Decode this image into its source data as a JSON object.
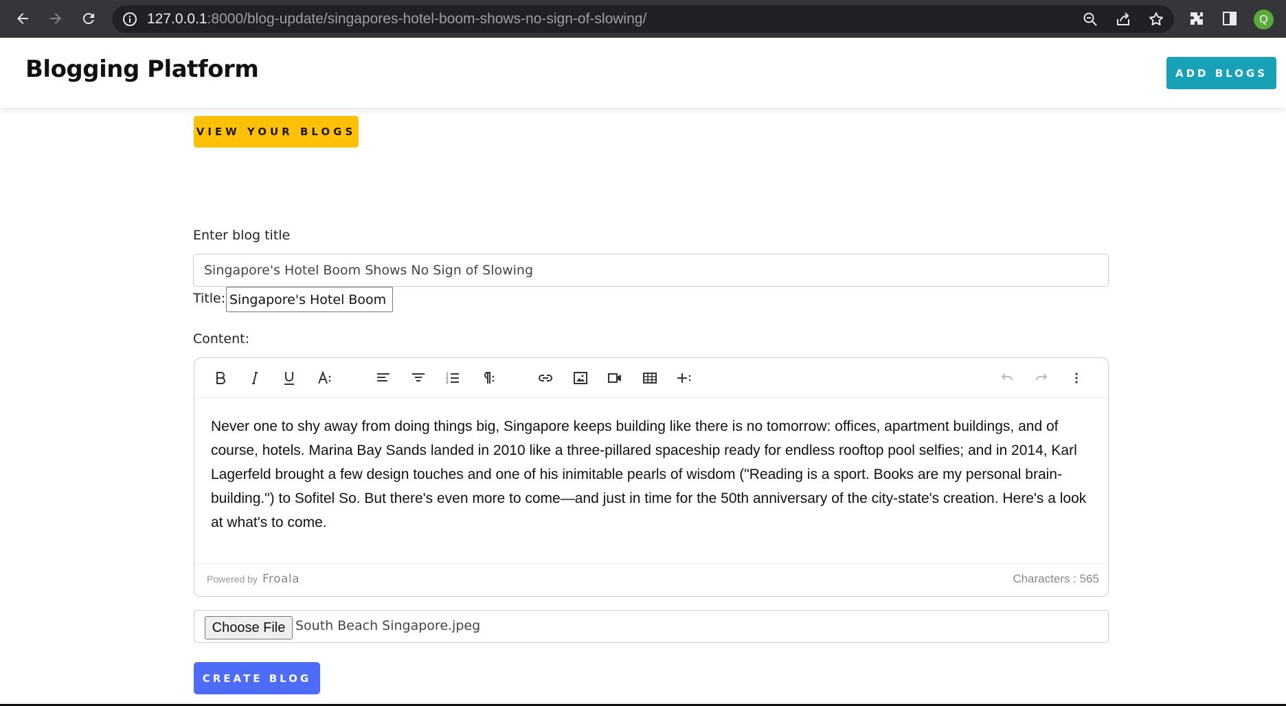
{
  "browser": {
    "url_host": "127.0.0.1",
    "url_rest": ":8000/blog-update/singapores-hotel-boom-shows-no-sign-of-slowing/",
    "profile_initial": "Q",
    "profile_color": "#5aab3c"
  },
  "header": {
    "brand": "Blogging Platform",
    "add_blogs_label": "ADD BLOGS"
  },
  "view_blogs_label": "VIEW YOUR BLOGS",
  "form": {
    "title_label": "Enter blog title",
    "title_value": "Singapore's Hotel Boom Shows No Sign of Slowing",
    "short_title_label": "Title:",
    "short_title_value": "Singapore's Hotel Boom",
    "content_label": "Content:"
  },
  "editor": {
    "toolbar_icons": [
      "bold-icon",
      "italic-icon",
      "underline-icon",
      "font-size-icon",
      "align-left-icon",
      "align-center-icon",
      "ordered-list-icon",
      "paragraph-format-icon",
      "link-icon",
      "image-icon",
      "video-icon",
      "table-icon",
      "insert-more-icon",
      "undo-icon",
      "redo-icon",
      "more-vertical-icon"
    ],
    "content": "Never one to shy away from doing things big, Singapore keeps building like there is no tomorrow: offices, apartment buildings, and of course, hotels. Marina Bay Sands landed in 2010 like a three-pillared spaceship ready for endless rooftop pool selfies; and in 2014, Karl Lagerfeld brought a few design touches and one of his inimitable pearls of wisdom (\"Reading is a sport. Books are my personal brain-building.\") to Sofitel So. But there's even more to come—and just in time for the 50th anniversary of the city-state's creation. Here's a look at what's to come.",
    "powered_by": "Powered by",
    "powered_brand": "Froala",
    "char_count": "Characters : 565"
  },
  "file": {
    "button_label": "Choose File",
    "file_name": "South Beach Singapore.jpeg"
  },
  "create_label": "CREATE BLOG",
  "colors": {
    "add_button": "#17a2b8",
    "view_button": "#ffc107",
    "create_button": "#4d6cfa"
  }
}
